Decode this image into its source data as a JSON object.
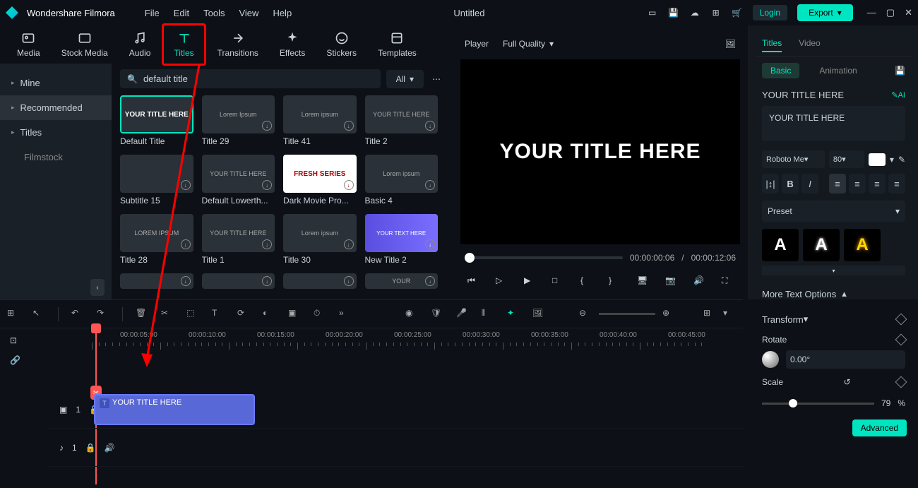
{
  "app": {
    "name": "Wondershare Filmora",
    "doc_title": "Untitled"
  },
  "menu": [
    "File",
    "Edit",
    "Tools",
    "View",
    "Help"
  ],
  "top": {
    "login": "Login",
    "export": "Export"
  },
  "asset_tabs": [
    {
      "id": "media",
      "label": "Media"
    },
    {
      "id": "stock",
      "label": "Stock Media"
    },
    {
      "id": "audio",
      "label": "Audio"
    },
    {
      "id": "titles",
      "label": "Titles"
    },
    {
      "id": "transitions",
      "label": "Transitions"
    },
    {
      "id": "effects",
      "label": "Effects"
    },
    {
      "id": "stickers",
      "label": "Stickers"
    },
    {
      "id": "templates",
      "label": "Templates"
    }
  ],
  "sidebar": {
    "items": [
      {
        "label": "Mine",
        "expand": true
      },
      {
        "label": "Recommended",
        "active": true
      },
      {
        "label": "Titles",
        "expand": true
      },
      {
        "label": "Filmstock",
        "indent": true
      }
    ]
  },
  "search": {
    "value": "default title",
    "filter": "All"
  },
  "thumbs": [
    {
      "label": "Default Title",
      "text": "YOUR TITLE HERE",
      "selected": true
    },
    {
      "label": "Title 29",
      "text": "Lorem Ipsum",
      "dl": true
    },
    {
      "label": "Title 41",
      "text": "Lorem ipsum",
      "dl": true
    },
    {
      "label": "Title 2",
      "text": "YOUR TITLE HERE",
      "dl": true,
      "boxed": true
    },
    {
      "label": "Subtitle 15",
      "text": "",
      "dl": true
    },
    {
      "label": "Default Lowerth...",
      "text": "YOUR TITLE HERE",
      "dl": true
    },
    {
      "label": "Dark Movie Pro...",
      "text": "FRESH SERIES",
      "dl": true,
      "fresh": true
    },
    {
      "label": "Basic 4",
      "text": "Lorem ipsum",
      "dl": true
    },
    {
      "label": "Title 28",
      "text": "LOREM IPSUM",
      "dl": true
    },
    {
      "label": "Title 1",
      "text": "YOUR TITLE HERE",
      "dl": true
    },
    {
      "label": "Title 30",
      "text": "Lorem ipsum",
      "dl": true
    },
    {
      "label": "New Title 2",
      "text": "YOUR TEXT HERE",
      "dl": true,
      "newtitle": true
    },
    {
      "label": "",
      "text": "",
      "dl": true,
      "partial": true
    },
    {
      "label": "",
      "text": "",
      "dl": true,
      "partial": true
    },
    {
      "label": "",
      "text": "",
      "dl": true,
      "partial": true
    },
    {
      "label": "",
      "text": "YOUR",
      "dl": true,
      "partial": true
    }
  ],
  "preview": {
    "player_label": "Player",
    "quality": "Full Quality",
    "title_text": "YOUR TITLE HERE",
    "current_time": "00:00:00:06",
    "sep": "/",
    "total_time": "00:00:12:06"
  },
  "right": {
    "tabs": [
      "Titles",
      "Video"
    ],
    "subtabs": [
      "Basic",
      "Animation"
    ],
    "title_name": "YOUR TITLE HERE",
    "ai": "AI",
    "text_value": "YOUR TITLE HERE",
    "font": "Roboto Me",
    "font_size": "80",
    "preset_label": "Preset",
    "more_opts": "More Text Options",
    "transform": "Transform",
    "rotate_label": "Rotate",
    "rotate_val": "0.00°",
    "scale_label": "Scale",
    "scale_val": "79",
    "scale_unit": "%",
    "advanced": "Advanced"
  },
  "timeline": {
    "ruler": [
      "00:00:05:00",
      "00:00:10:00",
      "00:00:15:00",
      "00:00:20:00",
      "00:00:25:00",
      "00:00:30:00",
      "00:00:35:00",
      "00:00:40:00",
      "00:00:45:00"
    ],
    "clip_text": "YOUR TITLE HERE",
    "track_indices": {
      "video": "1",
      "audio": "1"
    }
  }
}
